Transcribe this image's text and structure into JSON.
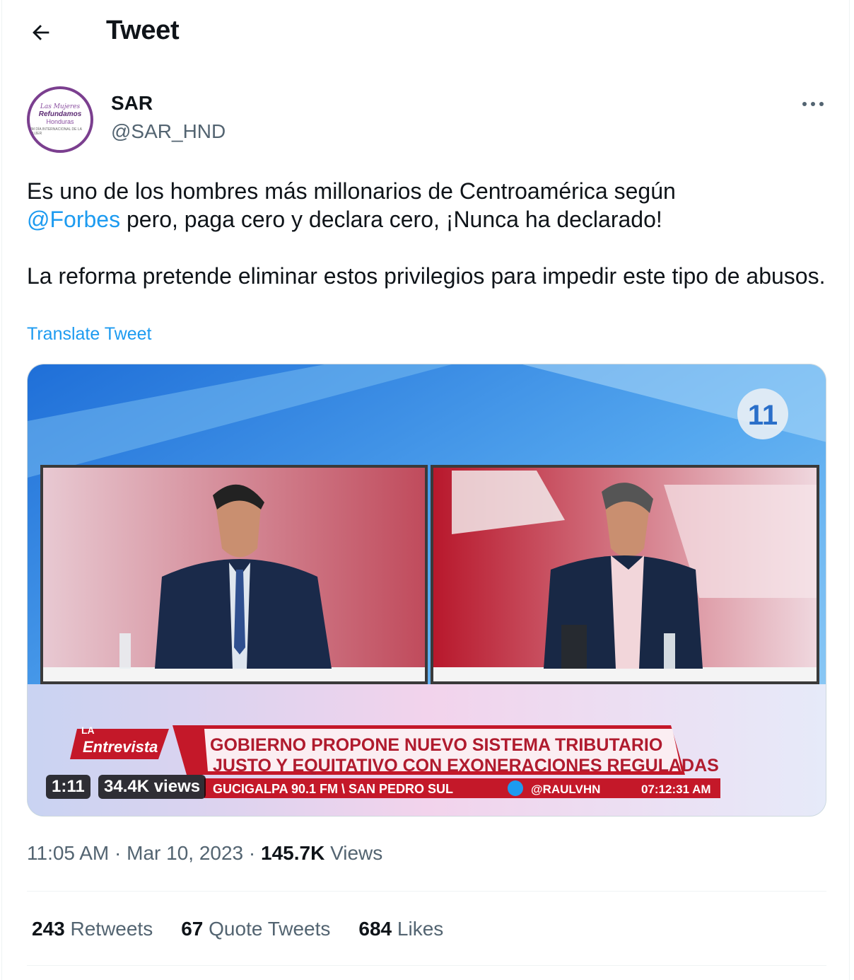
{
  "header": {
    "title": "Tweet",
    "back_icon": "arrow-left-icon"
  },
  "author": {
    "name": "SAR",
    "handle": "@SAR_HND",
    "avatar_lines": [
      "Las Mujeres",
      "Refundamos",
      "Honduras",
      "8M DÍA INTERNACIONAL DE LA MUJER"
    ],
    "avatar_border_color": "#7b3f8f"
  },
  "tweet": {
    "line1": "Es uno de los hombres más millonarios de Centroamérica según",
    "mention": "@Forbes",
    "line2_rest": " pero, paga cero y declara cero, ¡Nunca ha declarado!",
    "paragraph2": "La reforma pretende eliminar estos privilegios para impedir este tipo de abusos.",
    "translate_label": "Translate Tweet",
    "link_color": "#1d9bf0"
  },
  "video": {
    "duration": "1:11",
    "views": "34.4K views",
    "show_label": "Entrevista",
    "show_small": "LA",
    "headline1": "GOBIERNO PROPONE NUEVO SISTEMA TRIBUTARIO",
    "headline2": "JUSTO Y EQUITATIVO CON EXONERACIONES REGULADAS",
    "ticker": "GUCIGALPA 90.1 FM \\ SAN PEDRO SUL",
    "handle": "@RAULVHN",
    "clock": "07:12:31 AM",
    "channel_logo": "11"
  },
  "meta": {
    "time": "11:05 AM",
    "separator": " · ",
    "date": "Mar 10, 2023",
    "views_count": "145.7K",
    "views_label": " Views"
  },
  "stats": [
    {
      "count": "243",
      "label": " Retweets"
    },
    {
      "count": "67",
      "label": " Quote Tweets"
    },
    {
      "count": "684",
      "label": " Likes"
    }
  ]
}
